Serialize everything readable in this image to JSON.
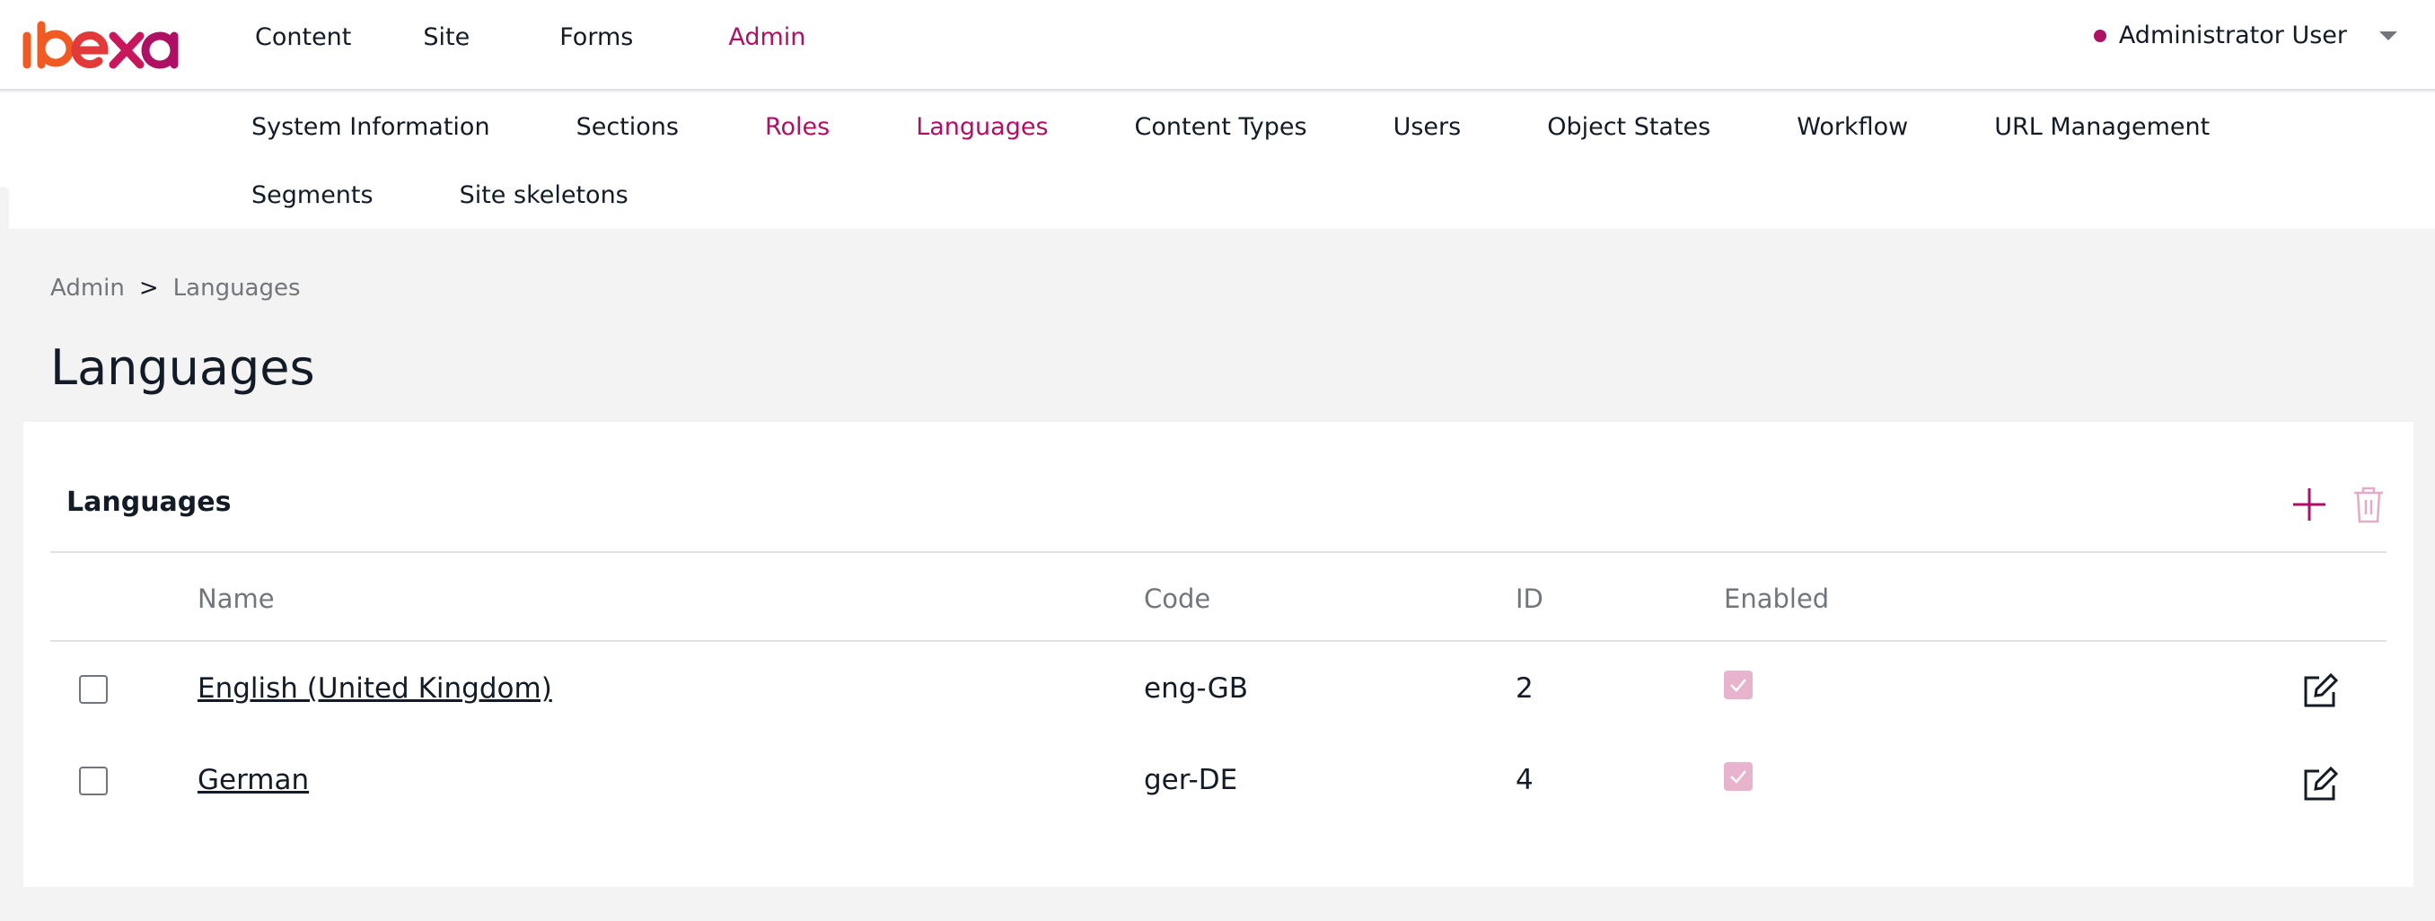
{
  "brand": {
    "logo_text": "ibexa",
    "accent": "#ae1164",
    "logo_color": "#f15a22"
  },
  "main_nav": [
    {
      "label": "Content",
      "active": false
    },
    {
      "label": "Site",
      "active": false
    },
    {
      "label": "Forms",
      "active": false
    },
    {
      "label": "Admin",
      "active": true
    }
  ],
  "user": {
    "name": "Administrator User"
  },
  "sub_nav": {
    "row1": [
      {
        "label": "System Information",
        "active": false
      },
      {
        "label": "Sections",
        "active": false
      },
      {
        "label": "Roles",
        "active": true
      },
      {
        "label": "Languages",
        "active": true
      },
      {
        "label": "Content Types",
        "active": false
      },
      {
        "label": "Users",
        "active": false
      },
      {
        "label": "Object States",
        "active": false
      },
      {
        "label": "Workflow",
        "active": false
      },
      {
        "label": "URL Management",
        "active": false
      }
    ],
    "row2": [
      {
        "label": "Segments",
        "active": false
      },
      {
        "label": "Site skeletons",
        "active": false
      }
    ]
  },
  "breadcrumb": {
    "parent": "Admin",
    "separator": ">",
    "current": "Languages"
  },
  "page": {
    "title": "Languages"
  },
  "card": {
    "title": "Languages",
    "actions": {
      "add_icon": "plus-icon",
      "delete_icon": "trash-icon"
    },
    "columns": {
      "name": "Name",
      "code": "Code",
      "id": "ID",
      "enabled": "Enabled"
    },
    "rows": [
      {
        "name": "English (United Kingdom)",
        "code": "eng-GB",
        "id": "2",
        "enabled": true
      },
      {
        "name": "German",
        "code": "ger-DE",
        "id": "4",
        "enabled": true
      }
    ]
  }
}
